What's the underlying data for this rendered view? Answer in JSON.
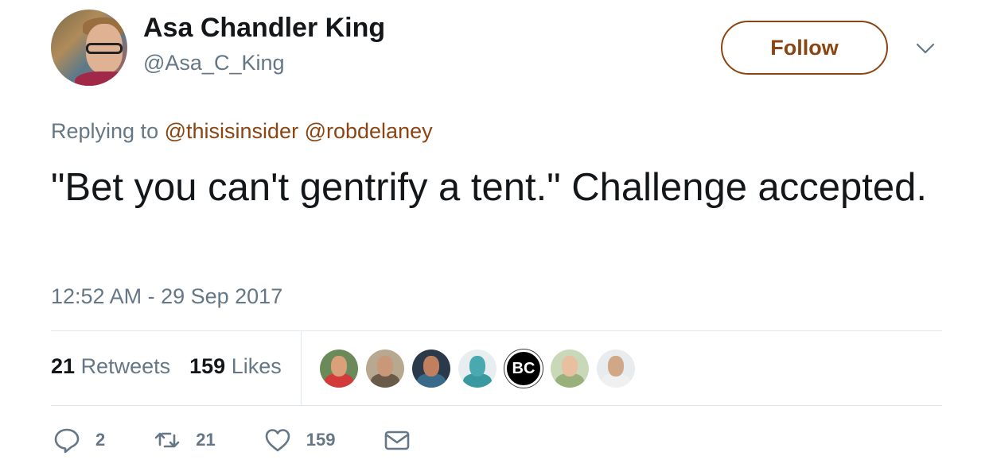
{
  "author": {
    "display_name": "Asa Chandler King",
    "handle": "@Asa_C_King"
  },
  "follow_button": {
    "label": "Follow"
  },
  "reply": {
    "prefix": "Replying to",
    "mentions": [
      "@thisisinsider",
      "@robdelaney"
    ]
  },
  "tweet": {
    "text": "\"Bet you can't gentrify a tent.\" Challenge accepted.",
    "timestamp": "12:52 AM - 29 Sep 2017"
  },
  "stats": {
    "retweets_count": "21",
    "retweets_label": "Retweets",
    "likes_count": "159",
    "likes_label": "Likes"
  },
  "likers": [
    {
      "icon": "avatar-red-shirt",
      "bg": "#6b8a5a",
      "face": "#d9a07a",
      "body": "#d33a3a"
    },
    {
      "icon": "avatar-couple",
      "bg": "#b8a890",
      "face": "#c89878",
      "body": "#6a5a4a"
    },
    {
      "icon": "avatar-sunglasses",
      "bg": "#2a3a4a",
      "face": "#c08060",
      "body": "#3a6a8a"
    },
    {
      "icon": "avatar-horse",
      "bg": "#e8eef0",
      "face": "#4aa8b0",
      "body": "#3a98a0"
    },
    {
      "icon": "avatar-bc-logo",
      "label": "BC"
    },
    {
      "icon": "avatar-glasses-woman",
      "bg": "#c8d8b8",
      "face": "#e8c0a0",
      "body": "#9ab07a"
    },
    {
      "icon": "avatar-man-outdoors",
      "bg": "#e8ecee",
      "face": "#d0a888",
      "body": "#f0f0f0"
    }
  ],
  "actions": {
    "reply_count": "2",
    "retweet_count": "21",
    "like_count": "159",
    "icons": [
      "reply-icon",
      "retweet-icon",
      "like-icon",
      "message-icon"
    ]
  },
  "colors": {
    "accent": "#8b4513",
    "secondary_text": "#657786",
    "primary_text": "#14171a",
    "divider": "#e1e8ed"
  }
}
